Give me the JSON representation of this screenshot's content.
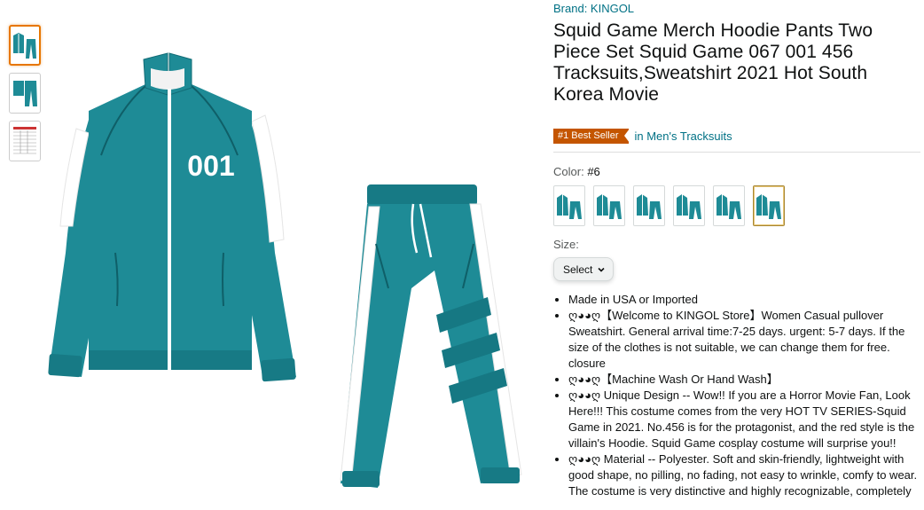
{
  "brand": "Brand: KINGOL",
  "title": "Squid Game Merch Hoodie Pants Two Piece Set Squid Game 067 001 456 Tracksuits,Sweatshirt 2021 Hot South Korea Movie",
  "best_seller": {
    "badge": "#1 Best Seller",
    "category": "in Men's Tracksuits"
  },
  "color": {
    "label": "Color:",
    "value": "#6",
    "selected_index": 5,
    "swatch_count": 6
  },
  "size": {
    "label": "Size:",
    "select_label": "Select"
  },
  "jacket_number": "001",
  "colors": {
    "teal": "#1E8B96",
    "teal_dark": "#126C76",
    "white": "#FFFFFF",
    "badge": "#C45500",
    "link": "#007185"
  },
  "bullets": [
    "Made in USA or Imported",
    "ღ◕◕ღ【Welcome to KINGOL Store】Women Casual pullover Sweatshirt. General arrival time:7-25 days. urgent: 5-7 days. If the size of the clothes is not suitable, we can change them for free. closure",
    "ღ◕◕ღ【Machine Wash Or Hand Wash】",
    "ღ◕◕ღ Unique Design -- Wow!! If you are a Horror Movie Fan, Look Here!!! This costume comes from the very HOT TV SERIES-Squid Game in 2021. No.456 is for the protagonist, and the red style is the villain's Hoodie. Squid Game cosplay costume will surprise you!!",
    "ღ◕◕ღ Material -- Polyester. Soft and skin-friendly, lightweight with good shape, no pilling, no fading, not easy to wrinkle, comfy to wear. The costume is very distinctive and highly recognizable, completely"
  ]
}
